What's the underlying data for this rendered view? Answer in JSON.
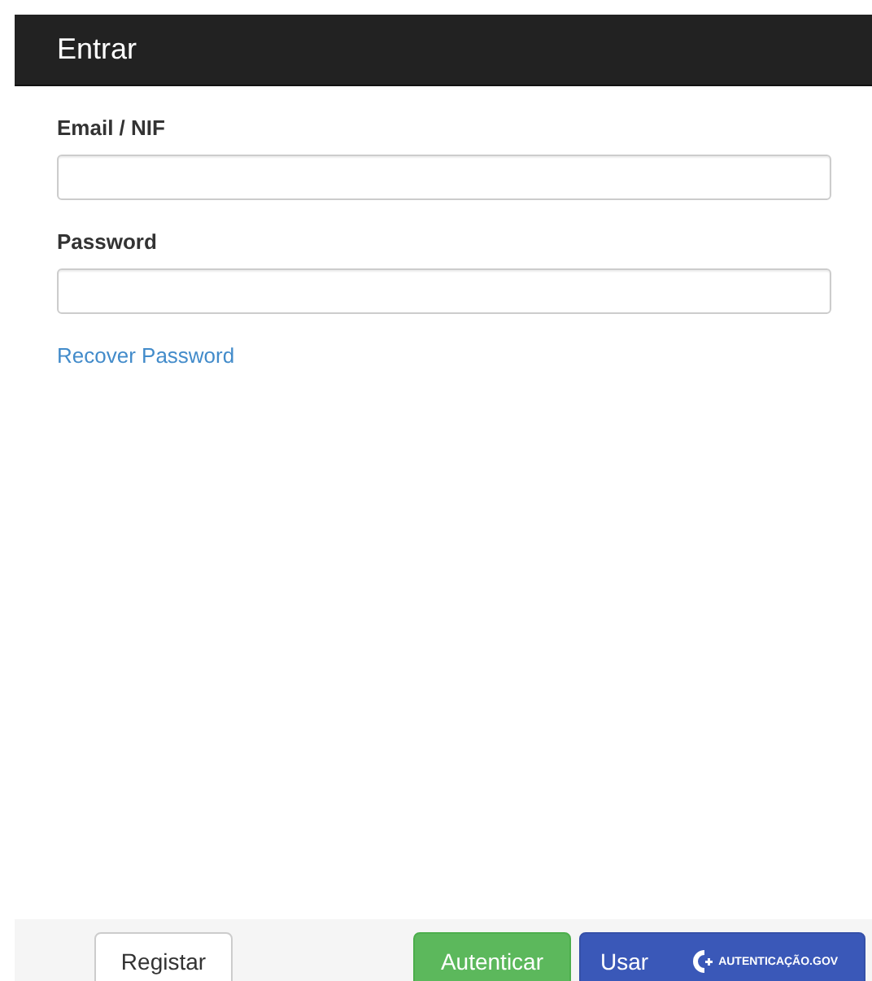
{
  "header": {
    "title": "Entrar"
  },
  "fields": [
    {
      "label": "Email / NIF"
    },
    {
      "label": "Password"
    }
  ],
  "recover_link": "Recover Password",
  "footer": {
    "register": "Registar",
    "authenticate": "Autenticar",
    "use": "Usar",
    "gov_logo": "AUTENTICAÇÃO.GOV"
  }
}
